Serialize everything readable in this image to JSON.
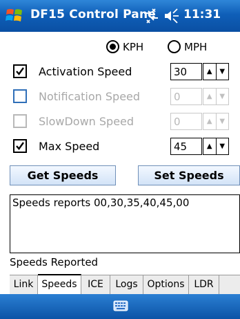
{
  "titlebar": {
    "title": "DF15 Control Pane",
    "clock": "11:31",
    "icons": [
      "windows-start-icon",
      "network-icon",
      "volume-icon"
    ]
  },
  "units": {
    "options": [
      {
        "label": "KPH",
        "selected": true
      },
      {
        "label": "MPH",
        "selected": false
      }
    ]
  },
  "speeds": [
    {
      "label": "Activation Speed",
      "checked": true,
      "enabled": true,
      "value": "30"
    },
    {
      "label": "Notification Speed",
      "checked": false,
      "enabled": false,
      "value": "0"
    },
    {
      "label": "SlowDown Speed",
      "checked": false,
      "enabled": false,
      "value": "0"
    },
    {
      "label": "Max Speed",
      "checked": true,
      "enabled": true,
      "value": "45"
    }
  ],
  "buttons": {
    "get": "Get Speeds",
    "set": "Set Speeds"
  },
  "output": {
    "text": "Speeds reports 00,30,35,40,45,00"
  },
  "status": "Speeds Reported",
  "tabs": [
    "Link",
    "Speeds",
    "ICE",
    "Logs",
    "Options",
    "LDR"
  ],
  "active_tab": "Speeds",
  "colors": {
    "titlebar": "#0f5fb8",
    "disabled_text": "#a8a8a8",
    "button_bg": "#d2e3f7"
  }
}
